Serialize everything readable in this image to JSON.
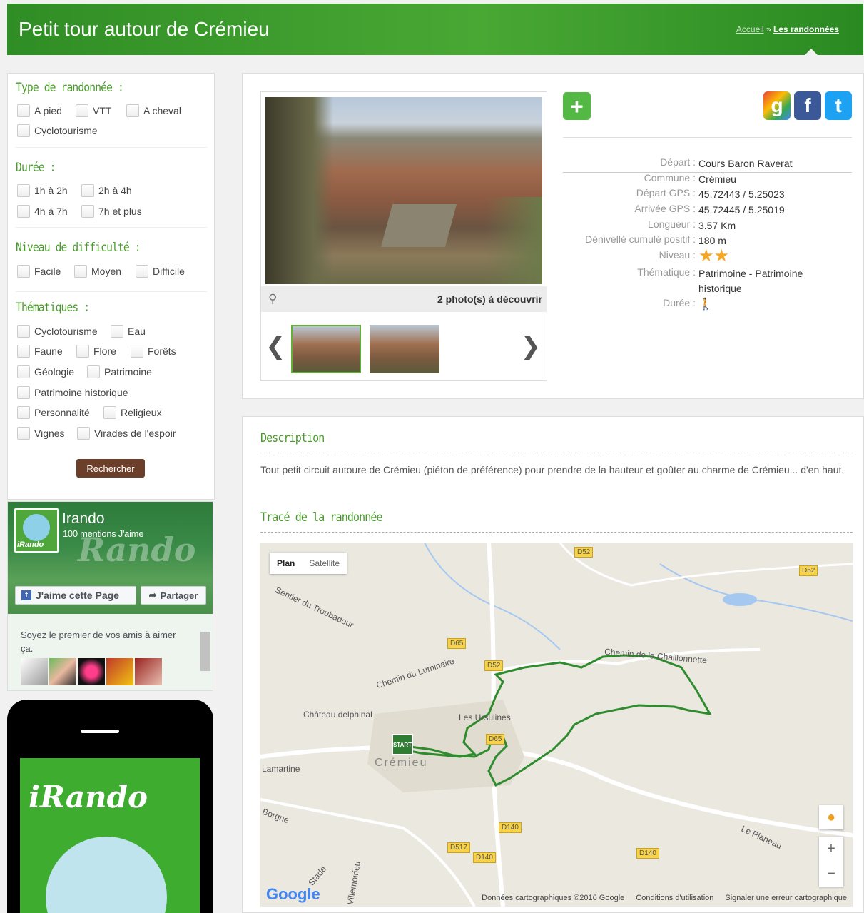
{
  "header": {
    "title": "Petit tour autour de Crémieu",
    "breadcrumb_home": "Accueil",
    "breadcrumb_sep": "»",
    "breadcrumb_current": "Les randonnées"
  },
  "filters": {
    "type_title": "Type de randonnée :",
    "type_options": [
      "A pied",
      "VTT",
      "A cheval",
      "Cyclotourisme"
    ],
    "duree_title": "Durée :",
    "duree_options": [
      "1h à 2h",
      "2h à 4h",
      "4h à 7h",
      "7h et plus"
    ],
    "niveau_title": "Niveau de difficulté :",
    "niveau_options": [
      "Facile",
      "Moyen",
      "Difficile"
    ],
    "thematiques_title": "Thématiques :",
    "thematiques_options": [
      "Cyclotourisme",
      "Eau",
      "Faune",
      "Flore",
      "Forêts",
      "Géologie",
      "Patrimoine",
      "Patrimoine historique",
      "Personnalité",
      "Religieux",
      "Vignes",
      "Virades de l'espoir"
    ],
    "search_label": "Rechercher"
  },
  "facebook": {
    "name": "Irando",
    "likes": "100 mentions J'aime",
    "logo_text": "iRando",
    "watermark": "Rando",
    "like_label": "J'aime cette Page",
    "share_label": "Partager",
    "friends_text": "Soyez le premier de vos amis à aimer ça."
  },
  "app_promo": {
    "brand": "iRando"
  },
  "gallery": {
    "count_label": "2 photo(s) à découvrir"
  },
  "social": {
    "plus": "+",
    "google": "g",
    "facebook": "f",
    "twitter": "t"
  },
  "details": {
    "rows": [
      {
        "label": "Départ :",
        "value": "Cours Baron Raverat"
      },
      {
        "label": "Commune :",
        "value": "Crémieu"
      },
      {
        "label": "Départ GPS :",
        "value": "45.72443 / 5.25023"
      },
      {
        "label": "Arrivée GPS :",
        "value": "45.72445 / 5.25019"
      },
      {
        "label": "Longueur :",
        "value": "3.57 Km"
      },
      {
        "label": "Dénivellé cumulé positif :",
        "value": "180 m"
      },
      {
        "label": "Niveau :",
        "value": ""
      },
      {
        "label": "Thématique :",
        "value": "Patrimoine - Patrimoine historique"
      },
      {
        "label": "Durée :",
        "value": ""
      }
    ],
    "niveau_stars": 2
  },
  "description": {
    "title": "Description",
    "text": "Tout petit circuit autoure de Crémieu (piéton de préférence) pour prendre de la hauteur et goûter au charme de Crémieu... d'en haut."
  },
  "map": {
    "title": "Tracé de la randonnée",
    "tab_plan": "Plan",
    "tab_satellite": "Satellite",
    "labels": [
      "Sentier du Troubadour",
      "Chemin du Luminaire",
      "Chemin de la Chaillonnette",
      "Château delphinal",
      "Les Ursulines",
      "Crémieu",
      "Lamartine",
      "Borgne",
      "Le Planeau",
      "Villemoirieu",
      "Stade"
    ],
    "roads": [
      "D52",
      "D52",
      "D65",
      "D52",
      "D65",
      "D140",
      "D517",
      "D140",
      "D140"
    ],
    "start_label": "START",
    "footer_data": "Données cartographiques ©2016 Google",
    "footer_terms": "Conditions d'utilisation",
    "footer_report": "Signaler une erreur cartographique",
    "google_logo": "Google",
    "zoom_in": "+",
    "zoom_out": "−"
  }
}
